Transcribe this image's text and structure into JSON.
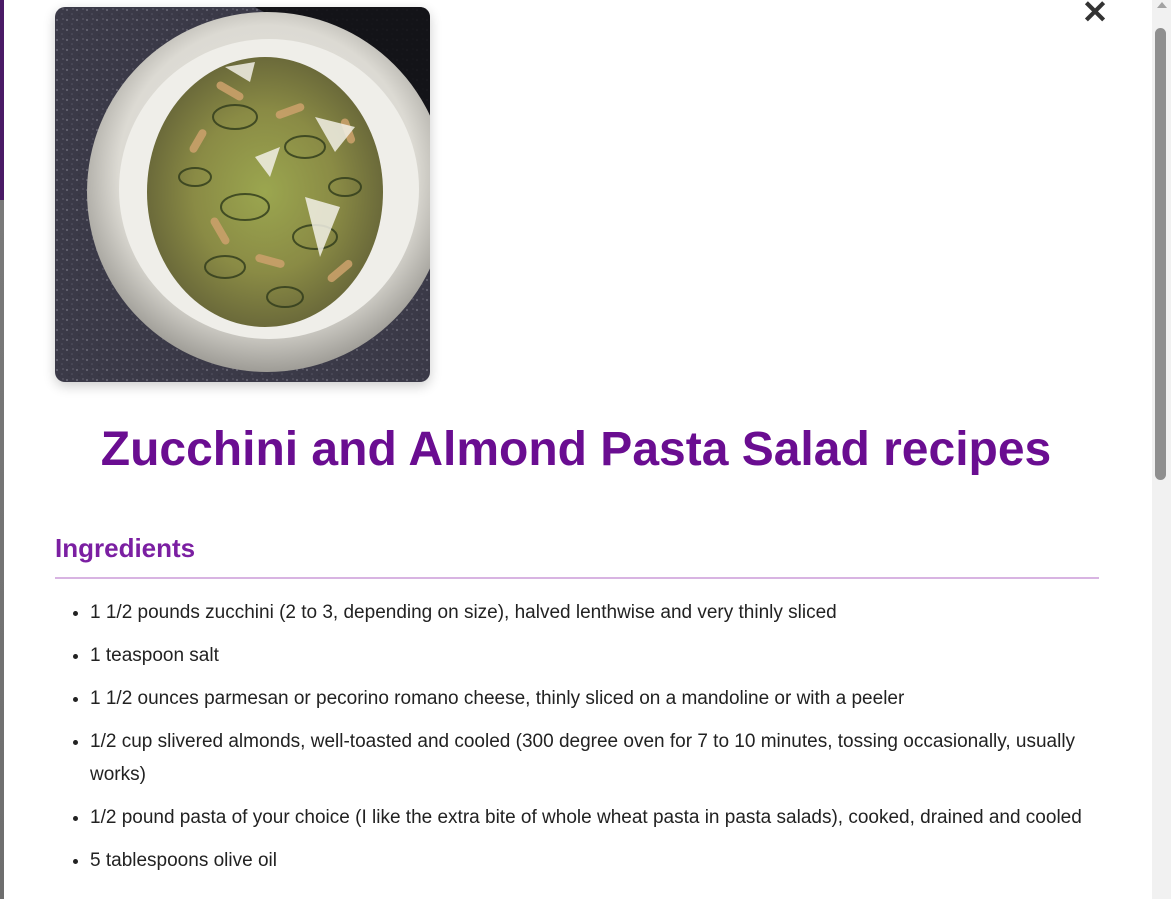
{
  "modal": {
    "close_label": "✕",
    "image_alt": "Zucchini and almond pasta salad in a white bowl",
    "title": "Zucchini and Almond Pasta Salad recipes",
    "ingredients_heading": "Ingredients",
    "ingredients": [
      "1 1/2 pounds zucchini (2 to 3, depending on size), halved lenthwise and very thinly sliced",
      "1 teaspoon salt",
      "1 1/2 ounces parmesan or pecorino romano cheese, thinly sliced on a mandoline or with a peeler",
      "1/2 cup slivered almonds, well-toasted and cooled (300 degree oven for 7 to 10 minutes, tossing occasionally, usually works)",
      "1/2 pound pasta of your choice (I like the extra bite of whole wheat pasta in pasta salads), cooked, drained and cooled",
      "5 tablespoons olive oil"
    ]
  },
  "colors": {
    "title": "#6a0d91",
    "heading": "#7b1fa2",
    "divider": "#d8b4e2"
  },
  "icons": {
    "close": "close-icon"
  }
}
